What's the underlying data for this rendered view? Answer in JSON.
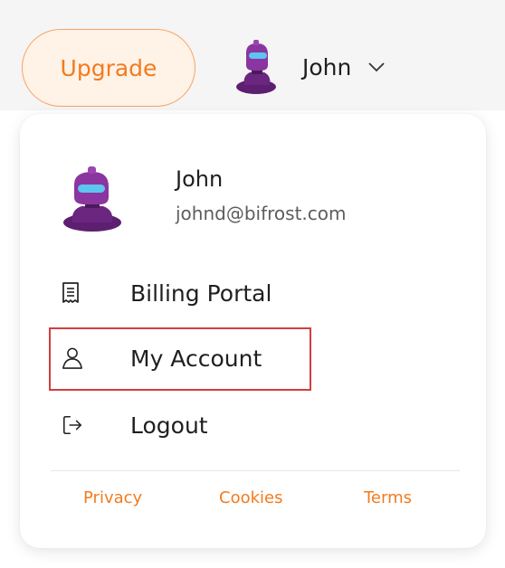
{
  "header": {
    "upgrade_label": "Upgrade",
    "user_name": "John",
    "avatar_icon": "robot-avatar-icon",
    "chevron_icon": "chevron-down-icon"
  },
  "dropdown": {
    "profile": {
      "name": "John",
      "email": "johnd@bifrost.com"
    },
    "items": [
      {
        "label": "Billing Portal",
        "icon": "receipt-icon"
      },
      {
        "label": "My Account",
        "icon": "user-icon",
        "highlighted": true
      },
      {
        "label": "Logout",
        "icon": "logout-icon"
      }
    ],
    "footer_links": [
      {
        "label": "Privacy"
      },
      {
        "label": "Cookies"
      },
      {
        "label": "Terms"
      }
    ]
  },
  "colors": {
    "accent": "#f37b1d",
    "highlight_border": "#d23e3e",
    "avatar_purple": "#7b2d8f"
  }
}
